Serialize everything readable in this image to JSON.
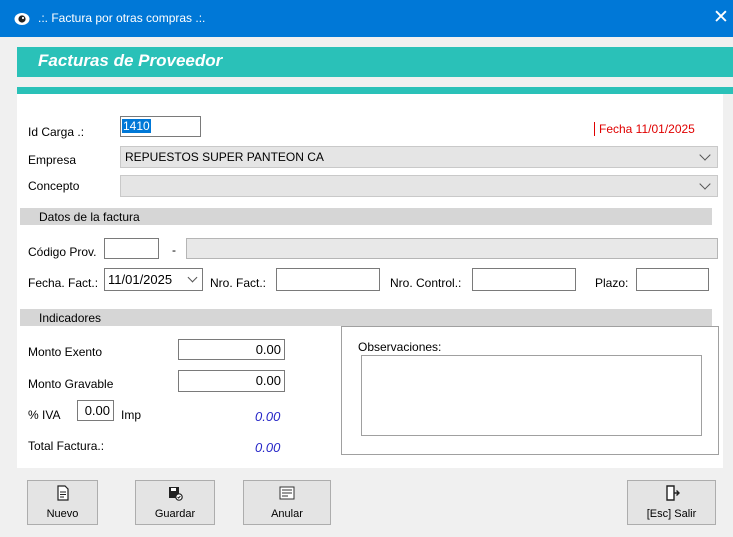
{
  "window": {
    "title": ".:. Factura por otras compras .:.",
    "close_glyph": "✕"
  },
  "banner": {
    "title": "Facturas de Proveedor"
  },
  "form": {
    "id_carga_label": "Id Carga .:",
    "id_carga_value": "1410",
    "fecha_label": "Fecha 11/01/2025",
    "empresa_label": "Empresa",
    "empresa_value": "REPUESTOS SUPER PANTEON CA",
    "concepto_label": "Concepto",
    "concepto_value": "",
    "section_factura": "Datos de la factura",
    "codigo_prov_label": "Código Prov.",
    "codigo_prov_value": "",
    "codigo_sep": "-",
    "proveedor_nombre": "",
    "fecha_fact_label": "Fecha. Fact.:",
    "fecha_fact_value": "11/01/2025",
    "nro_fact_label": "Nro. Fact.:",
    "nro_fact_value": "",
    "nro_control_label": "Nro. Control.:",
    "nro_control_value": "",
    "plazo_label": "Plazo:",
    "plazo_value": "",
    "section_indicadores": "Indicadores",
    "monto_exento_label": "Monto Exento",
    "monto_exento_value": "0.00",
    "monto_gravable_label": "Monto Gravable",
    "monto_gravable_value": "0.00",
    "iva_label": "% IVA",
    "iva_value": "0.00",
    "imp_label": "Imp",
    "imp_value": "0.00",
    "total_label": "Total Factura.:",
    "total_value": "0.00",
    "observaciones_label": "Observaciones:",
    "observaciones_value": ""
  },
  "buttons": {
    "nuevo": "Nuevo",
    "guardar": "Guardar",
    "anular": "Anular",
    "salir": "[Esc] Salir"
  },
  "icons": {
    "app": "eye-icon",
    "nuevo": "new-document-icon",
    "guardar": "save-icon",
    "anular": "cancel-document-icon",
    "salir": "exit-door-icon"
  },
  "colors": {
    "titlebar": "#0078d7",
    "banner": "#2ac1b8",
    "fecha_text": "#e00000",
    "totals": "#2828c8"
  }
}
